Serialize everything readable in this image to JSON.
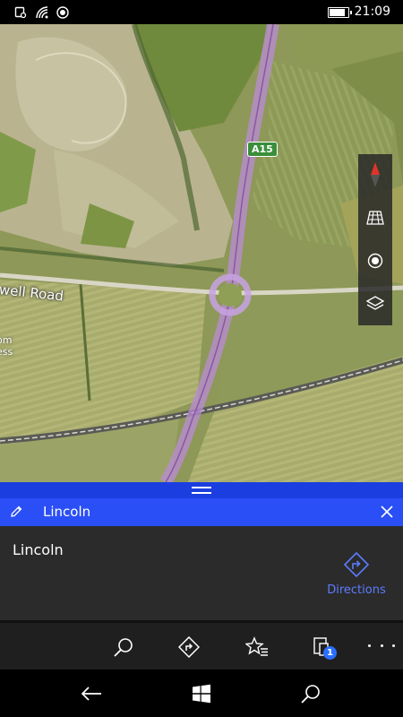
{
  "status_bar": {
    "time": "21:09",
    "battery_level": 0.85
  },
  "map": {
    "road_label": "well Road",
    "side_label": "om\ness",
    "route_shield": "A15",
    "colors": {
      "route": "#b98cd6",
      "roundabout": "#c7a2e3"
    },
    "controls": [
      "compass-icon",
      "aerial-3d-icon",
      "my-location-icon",
      "map-layers-icon"
    ]
  },
  "panel": {
    "title": "Lincoln",
    "place_name": "Lincoln",
    "directions_label": "Directions",
    "accent": "#2b4ff6"
  },
  "app_bar": {
    "items": [
      "search-icon",
      "directions-icon",
      "favorites-icon",
      "devices-icon",
      "more-icon"
    ],
    "badge_count": "1"
  },
  "nav_bar": {
    "items": [
      "back-icon",
      "windows-start-icon",
      "search-icon"
    ]
  }
}
